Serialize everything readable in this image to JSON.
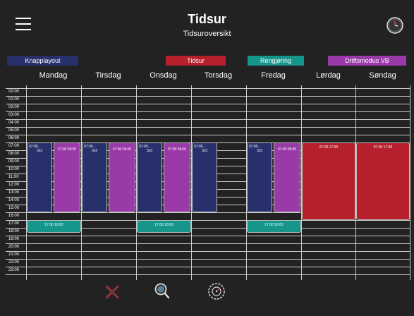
{
  "header": {
    "title": "Tidsur",
    "subtitle": "Tidsuroversikt",
    "menu_icon": "hamburger-menu-icon",
    "clock_icon": "clock-icon"
  },
  "legend": [
    {
      "label": "Knapplayout",
      "color": "#27306a"
    },
    {
      "label": "Tidsur",
      "color": "#b5202c"
    },
    {
      "label": "Rengjøring",
      "color": "#16958a"
    },
    {
      "label": "Driftsmodus VB",
      "color": "#9a3aa8"
    }
  ],
  "days": [
    "Mandag",
    "Tirsdag",
    "Onsdag",
    "Torsdag",
    "Fredag",
    "Lørdag",
    "Søndag"
  ],
  "hours": [
    "00:00",
    "01:00",
    "02:00",
    "03:00",
    "04:00",
    "05:00",
    "06:00",
    "07:00",
    "08:00",
    "09:00",
    "10:00",
    "11:00",
    "12:00",
    "13:00",
    "14:00",
    "15:00",
    "16:00",
    "17:00",
    "18:00",
    "19:00",
    "20:00",
    "21:00",
    "22:00",
    "23:00"
  ],
  "events": [
    {
      "type": "knapplayout",
      "day": 0,
      "label": "07:00...",
      "sub": "3x3",
      "start": 7,
      "end": 16
    },
    {
      "type": "driftsmodus",
      "day": 0,
      "label": "07:00 08:00",
      "sub": "",
      "start": 7,
      "end": 16
    },
    {
      "type": "knapplayout",
      "day": 1,
      "label": "07:00...",
      "sub": "3x3",
      "start": 7,
      "end": 16
    },
    {
      "type": "driftsmodus",
      "day": 1,
      "label": "07:00 08:00",
      "sub": "",
      "start": 7,
      "end": 16
    },
    {
      "type": "knapplayout",
      "day": 2,
      "label": "07:00...",
      "sub": "3x3",
      "start": 7,
      "end": 16
    },
    {
      "type": "driftsmodus",
      "day": 2,
      "label": "07:00 08:00",
      "sub": "",
      "start": 7,
      "end": 16
    },
    {
      "type": "knapplayout",
      "day": 3,
      "label": "07:00...",
      "sub": "3x3",
      "start": 7,
      "end": 16
    },
    {
      "type": "knapplayout",
      "day": 4,
      "label": "07:00...",
      "sub": "3x3",
      "start": 7,
      "end": 16
    },
    {
      "type": "driftsmodus",
      "day": 4,
      "label": "07:00 08:00",
      "sub": "",
      "start": 7,
      "end": 16
    },
    {
      "type": "tidsur",
      "day": 5,
      "label": "07:00 17:00",
      "sub": "",
      "start": 7,
      "end": 17
    },
    {
      "type": "tidsur",
      "day": 6,
      "label": "07:00 17:00",
      "sub": "",
      "start": 7,
      "end": 17
    },
    {
      "type": "rengjoring",
      "day": 0,
      "label": "17:00 18:00",
      "sub": "",
      "start": 17,
      "end": 19
    },
    {
      "type": "rengjoring",
      "day": 2,
      "label": "17:00 18:00",
      "sub": "",
      "start": 17,
      "end": 19
    },
    {
      "type": "rengjoring",
      "day": 4,
      "label": "17:00 18:00",
      "sub": "",
      "start": 17,
      "end": 19
    }
  ],
  "toolbar": {
    "delete_icon": "delete-x-icon",
    "search_icon": "zoom-search-icon",
    "timer_icon": "timer-gauge-icon"
  }
}
